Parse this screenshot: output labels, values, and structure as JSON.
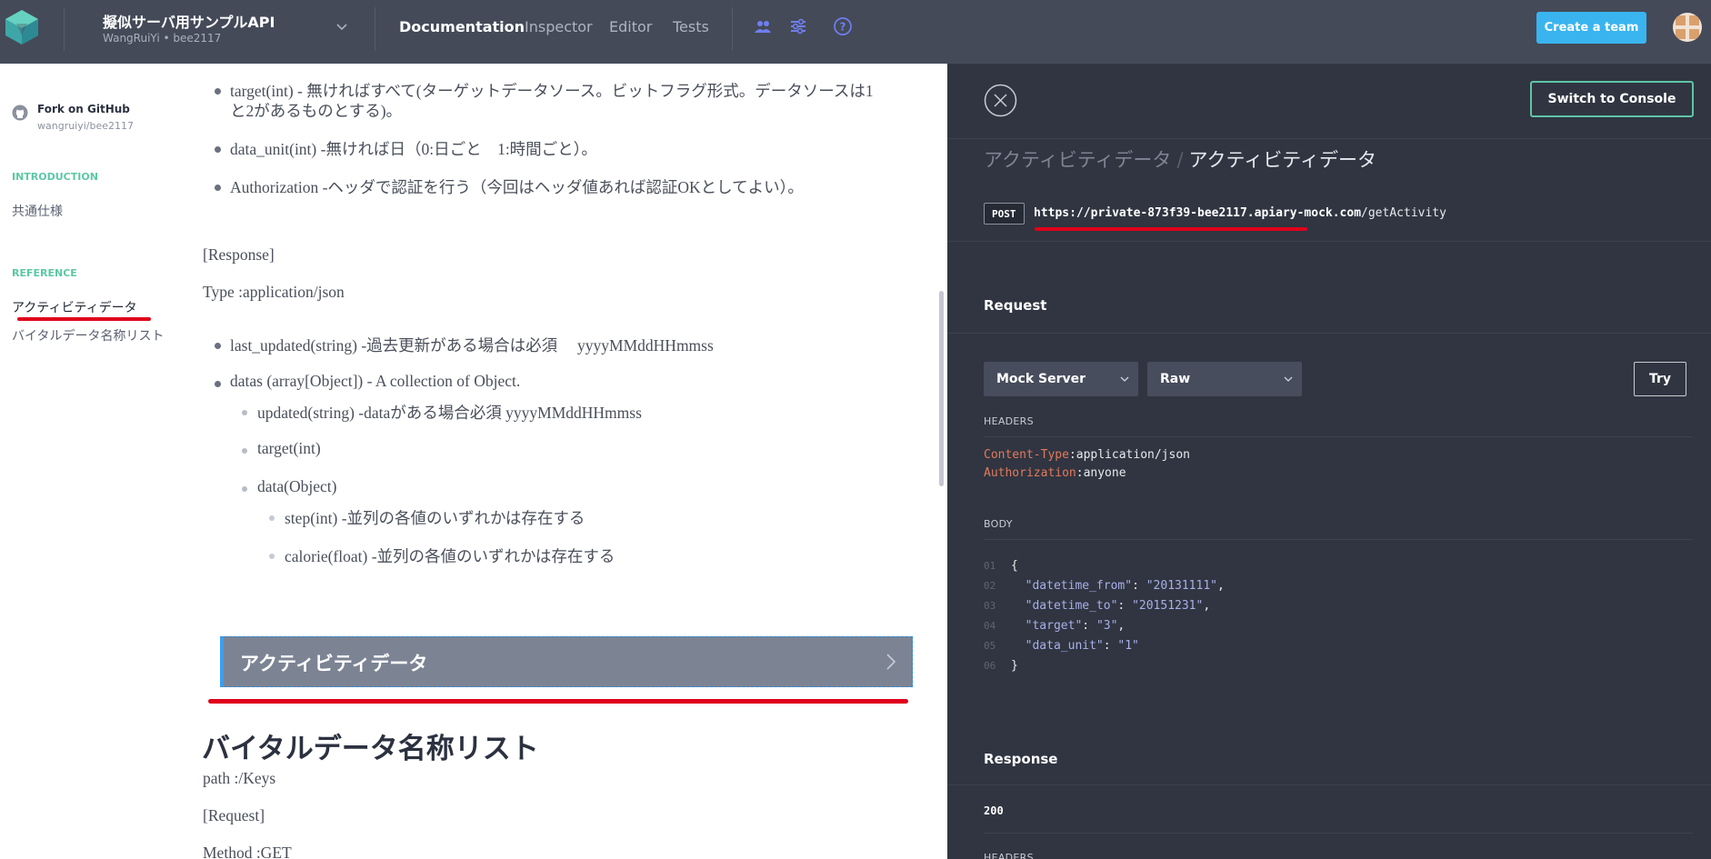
{
  "topbar": {
    "project_title": "擬似サーバ用サンプルAPI",
    "project_subtitle": "WangRuiYi • bee2117",
    "tabs": [
      {
        "label": "Documentation",
        "active": true
      },
      {
        "label": "Inspector",
        "active": false
      },
      {
        "label": "Editor",
        "active": false
      },
      {
        "label": "Tests",
        "active": false
      }
    ],
    "icons": [
      "team-icon",
      "settings-sliders-icon",
      "help-icon"
    ],
    "create_team_label": "Create a team",
    "accent_color": "#3ab4ef"
  },
  "sidebar": {
    "fork_label": "Fork on GitHub",
    "fork_repo": "wangruiyi/bee2117",
    "sections": [
      {
        "title": "INTRODUCTION",
        "items": [
          "共通仕様"
        ]
      },
      {
        "title": "REFERENCE",
        "items": [
          "アクティビティデータ",
          "バイタルデータ名称リスト"
        ]
      }
    ]
  },
  "main": {
    "bullets_top": [
      {
        "line1": "target(int) - 無ければすべて(ターゲットデータソース。ビットフラグ形式。データソースは1",
        "line2": "と2があるものとする)。"
      },
      {
        "text": "data_unit(int) -無ければ日（0:日ごと　1:時間ごと）。"
      },
      {
        "text": "Authorization -ヘッダで認証を行う（今回はヘッダ値あれば認証OKとしてよい）。"
      }
    ],
    "response_label": "[Response]",
    "type_line": "Type :application/json",
    "last_updated": "last_updated(string) -過去更新がある場合は必須　 yyyyMMddHHmmss",
    "datas": "datas (array[Object]) - A collection of Object.",
    "sub_updated": "updated(string) -dataがある場合必須 yyyyMMddHHmmss",
    "sub_target": "target(int)",
    "sub_data": "data(Object)",
    "sub_step": "step(int) -並列の各値のいずれかは存在する",
    "sub_calorie": "calorie(float) -並列の各値のいずれかは存在する",
    "action_label": "アクティビティデータ",
    "section_heading": "バイタルデータ名称リスト",
    "path_line": "path :/Keys",
    "request_label": "[Request]",
    "method_line": "Method :GET"
  },
  "console": {
    "switch_label": "Switch to Console",
    "breadcrumb": [
      "アクティビティデータ",
      "アクティビティデータ"
    ],
    "breadcrumb_sep": "/",
    "method": "POST",
    "url_host": "https://private-873f39-bee2117.apiary-mock.com",
    "url_path": "/getActivity",
    "request_title": "Request",
    "server_select": "Mock Server",
    "format_select": "Raw",
    "try_label": "Try",
    "headers_title": "HEADERS",
    "headers": [
      {
        "key": "Content-Type",
        "value": "application/json"
      },
      {
        "key": "Authorization",
        "value": "anyone"
      }
    ],
    "body_title": "BODY",
    "body_lines": [
      {
        "num": "01",
        "text": "{"
      },
      {
        "num": "02",
        "key": "\"datetime_from\"",
        "value": "\"20131111\"",
        "comma": ","
      },
      {
        "num": "03",
        "key": "\"datetime_to\"",
        "value": "\"20151231\"",
        "comma": ","
      },
      {
        "num": "04",
        "key": "\"target\"",
        "value": "\"3\"",
        "comma": ","
      },
      {
        "num": "05",
        "key": "\"data_unit\"",
        "value": "\"1\"",
        "comma": ""
      },
      {
        "num": "06",
        "text": "}"
      }
    ],
    "response_title": "Response",
    "status_code": "200",
    "headers2_title": "HEADERS"
  },
  "colors": {
    "topbar_bg": "#444a58",
    "panel_bg": "#303541",
    "accent_green": "#5fc5a4",
    "annotation_red": "#e0001b"
  }
}
